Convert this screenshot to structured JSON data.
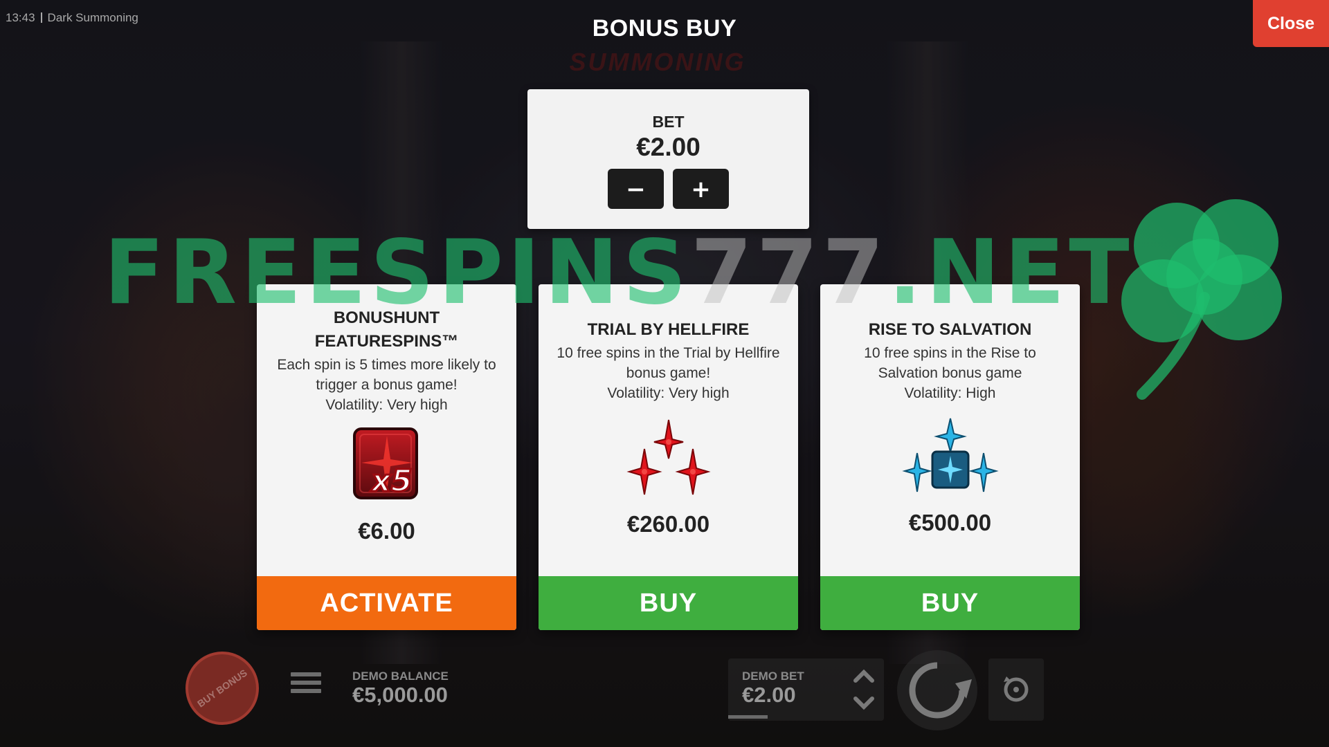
{
  "status_bar": {
    "time": "13:43",
    "game_name": "Dark Summoning"
  },
  "background_logo": "SUMMONING",
  "header": {
    "title": "BONUS BUY",
    "close_label": "Close"
  },
  "bet": {
    "label": "BET",
    "value": "€2.00",
    "minus_symbol": "−",
    "plus_symbol": "+"
  },
  "watermark": {
    "left": "FREESPINS",
    "mid": "777",
    "right": ".NET"
  },
  "cards": [
    {
      "title_line1": "BONUSHUNT",
      "title_line2": "FEATURESPINS™",
      "desc_line1": "Each spin is 5 times more likely to",
      "desc_line2": "trigger a bonus game!",
      "desc_line3": "Volatility: Very high",
      "icon": "bonushunt-x5-icon",
      "icon_text": "x5",
      "price": "€6.00",
      "action": "ACTIVATE",
      "action_color": "#f26a10"
    },
    {
      "title": "TRIAL BY HELLFIRE",
      "desc_line1": "10 free spins in the Trial by Hellfire",
      "desc_line2": "bonus game!",
      "desc_line3": "Volatility: Very high",
      "icon": "red-crosses-icon",
      "price": "€260.00",
      "action": "BUY",
      "action_color": "#3fae3f"
    },
    {
      "title": "RISE TO SALVATION",
      "desc_line1": "10 free spins in the Rise to",
      "desc_line2": "Salvation bonus game",
      "desc_line3": "Volatility: High",
      "icon": "blue-crosses-icon",
      "price": "€500.00",
      "action": "BUY",
      "action_color": "#3fae3f"
    }
  ],
  "bottom_bar": {
    "buy_bonus_label": "BUY BONUS",
    "balance_label": "DEMO BALANCE",
    "balance_value": "€5,000.00",
    "demo_bet_label": "DEMO BET",
    "demo_bet_value": "€2.00"
  },
  "colors": {
    "close": "#e04030",
    "activate": "#f26a10",
    "buy": "#3fae3f",
    "watermark": "#1ebe6e"
  }
}
